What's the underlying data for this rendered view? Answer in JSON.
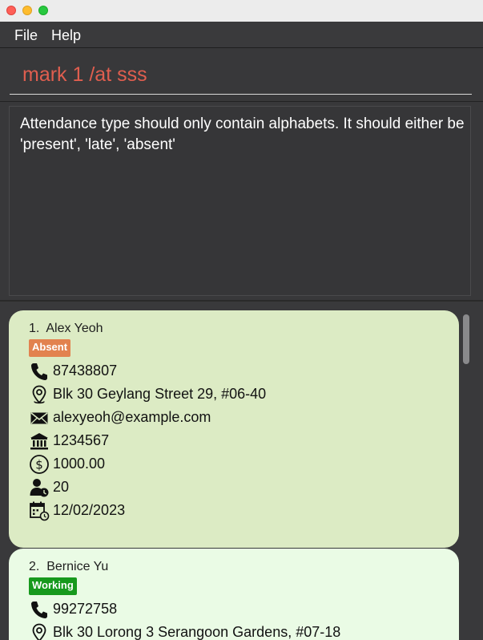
{
  "menu": {
    "file": "File",
    "help": "Help"
  },
  "command": {
    "value": "mark 1 /at sss"
  },
  "result": {
    "message": "Attendance type should only contain alphabets. It should either be 'present', 'late', 'absent'"
  },
  "persons": [
    {
      "index": "1.",
      "name": "Alex Yeoh",
      "status": "Absent",
      "status_color": "#e2824f",
      "phone": "87438807",
      "address": "Blk 30 Geylang Street 29, #06-40",
      "email": "alexyeoh@example.com",
      "bank_account": "1234567",
      "salary": "1000.00",
      "leaves": "20",
      "date": "12/02/2023"
    },
    {
      "index": "2.",
      "name": "Bernice Yu",
      "status": "Working",
      "status_color": "#17991d",
      "phone": "99272758",
      "address": "Blk 30 Lorong 3 Serangoon Gardens, #07-18"
    }
  ],
  "colors": {
    "card_selected": "#dcebc4",
    "card_default": "#eafbe5",
    "command_text": "#e05e4f"
  }
}
